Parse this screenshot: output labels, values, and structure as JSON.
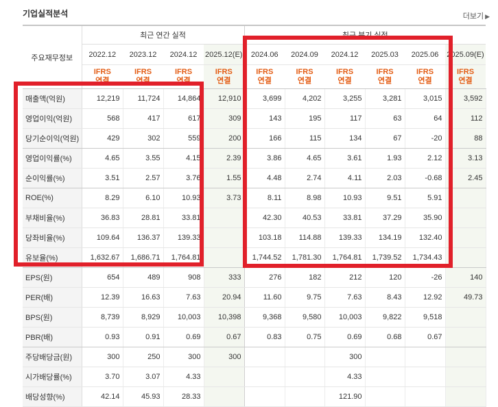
{
  "section_title": "기업실적분석",
  "more_label": "더보기",
  "more_icon": "arrow-right-icon",
  "header": {
    "stub_label": "주요재무정보",
    "annual_title": "최근 연간 실적",
    "quarter_title": "최근 분기 실적",
    "periods": [
      "2022.12",
      "2023.12",
      "2024.12",
      "2025.12(E)",
      "2024.06",
      "2024.09",
      "2024.12",
      "2025.03",
      "2025.06",
      "2025.09(E)"
    ],
    "basis_top": "IFRS",
    "basis_bottom": "연결"
  },
  "rows": [
    {
      "label": "매출액(억원)",
      "values": [
        "12,219",
        "11,724",
        "14,864",
        "12,910",
        "3,699",
        "4,202",
        "3,255",
        "3,281",
        "3,015",
        "3,592"
      ]
    },
    {
      "label": "영업이익(억원)",
      "values": [
        "568",
        "417",
        "617",
        "309",
        "143",
        "195",
        "117",
        "63",
        "64",
        "112"
      ]
    },
    {
      "label": "당기순이익(억원)",
      "values": [
        "429",
        "302",
        "559",
        "200",
        "166",
        "115",
        "134",
        "67",
        "-20",
        "88"
      ]
    },
    {
      "label": "영업이익률(%)",
      "values": [
        "4.65",
        "3.55",
        "4.15",
        "2.39",
        "3.86",
        "4.65",
        "3.61",
        "1.93",
        "2.12",
        "3.13"
      ]
    },
    {
      "label": "순이익률(%)",
      "values": [
        "3.51",
        "2.57",
        "3.76",
        "1.55",
        "4.48",
        "2.74",
        "4.11",
        "2.03",
        "-0.68",
        "2.45"
      ]
    },
    {
      "label": "ROE(%)",
      "values": [
        "8.29",
        "6.10",
        "10.93",
        "3.73",
        "8.11",
        "8.98",
        "10.93",
        "9.51",
        "5.91",
        ""
      ]
    },
    {
      "label": "부채비율(%)",
      "values": [
        "36.83",
        "28.81",
        "33.81",
        "",
        "42.30",
        "40.53",
        "33.81",
        "37.29",
        "35.90",
        ""
      ]
    },
    {
      "label": "당좌비율(%)",
      "values": [
        "109.64",
        "136.37",
        "139.33",
        "",
        "103.18",
        "114.88",
        "139.33",
        "134.19",
        "132.40",
        ""
      ]
    },
    {
      "label": "유보율(%)",
      "values": [
        "1,632.67",
        "1,686.71",
        "1,764.81",
        "",
        "1,744.52",
        "1,781.30",
        "1,764.81",
        "1,739.52",
        "1,734.43",
        ""
      ]
    },
    {
      "label": "EPS(원)",
      "values": [
        "654",
        "489",
        "908",
        "333",
        "276",
        "182",
        "212",
        "120",
        "-26",
        "140"
      ]
    },
    {
      "label": "PER(배)",
      "values": [
        "12.39",
        "16.63",
        "7.63",
        "20.94",
        "11.60",
        "9.75",
        "7.63",
        "8.43",
        "12.92",
        "49.73"
      ]
    },
    {
      "label": "BPS(원)",
      "values": [
        "8,739",
        "8,929",
        "10,003",
        "10,398",
        "9,368",
        "9,580",
        "10,003",
        "9,822",
        "9,518",
        ""
      ]
    },
    {
      "label": "PBR(배)",
      "values": [
        "0.93",
        "0.91",
        "0.69",
        "0.67",
        "0.83",
        "0.75",
        "0.69",
        "0.68",
        "0.67",
        ""
      ]
    },
    {
      "label": "주당배당금(원)",
      "values": [
        "300",
        "250",
        "300",
        "300",
        "",
        "",
        "300",
        "",
        "",
        ""
      ]
    },
    {
      "label": "시가배당률(%)",
      "values": [
        "3.70",
        "3.07",
        "4.33",
        "",
        "",
        "",
        "4.33",
        "",
        "",
        ""
      ]
    },
    {
      "label": "배당성향(%)",
      "values": [
        "42.14",
        "45.93",
        "28.33",
        "",
        "",
        "",
        "121.90",
        "",
        "",
        ""
      ]
    }
  ],
  "colors": {
    "highlight_box": "#e1202a",
    "basis_text": "#e35b12",
    "negative": "#e3261b",
    "estimate_bg": "#f4f7f0"
  }
}
